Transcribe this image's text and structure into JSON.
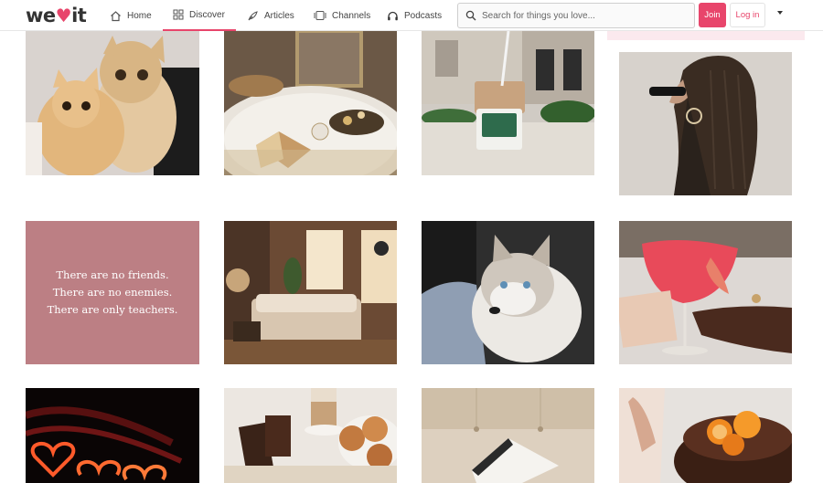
{
  "header": {
    "logo_text_left": "we",
    "logo_text_right": "it",
    "nav": [
      {
        "label": "Home",
        "icon": "home-icon"
      },
      {
        "label": "Discover",
        "icon": "grid-icon",
        "active": true
      },
      {
        "label": "Articles",
        "icon": "feather-icon"
      },
      {
        "label": "Channels",
        "icon": "channels-icon"
      },
      {
        "label": "Podcasts",
        "icon": "headphones-icon"
      }
    ],
    "search": {
      "placeholder": "Search for things you love..."
    },
    "join_label": "Join",
    "login_label": "Log in"
  },
  "grid": {
    "quote": {
      "line1": "There are no friends.",
      "line2": "There are no enemies.",
      "line3": "There are only teachers."
    }
  },
  "colors": {
    "accent": "#e8456b",
    "quote_bg": "#bc7f84"
  }
}
